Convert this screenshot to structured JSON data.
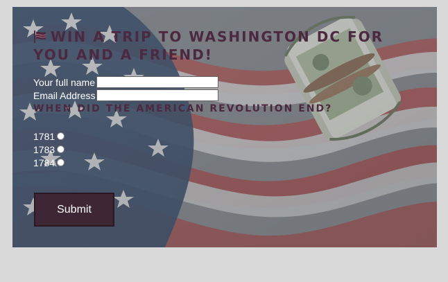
{
  "title": {
    "text": "WIN A TRIP TO WASHINGTON DC FOR YOU AND A FRIEND!",
    "icon": "flag-icon"
  },
  "form": {
    "full_name_label": "Your full name",
    "full_name_value": "",
    "email_label": "Email Address",
    "email_value": "",
    "question": "WHEN DID THE AMERICAN REVOLUTION END?",
    "options": [
      {
        "label": "1781",
        "selected": false
      },
      {
        "label": "1783",
        "selected": false
      },
      {
        "label": "1784",
        "selected": false
      }
    ],
    "submit_label": "Submit"
  },
  "colors": {
    "title": "#4c2940",
    "button": "#3f2634",
    "page": "#d8d8d8"
  }
}
